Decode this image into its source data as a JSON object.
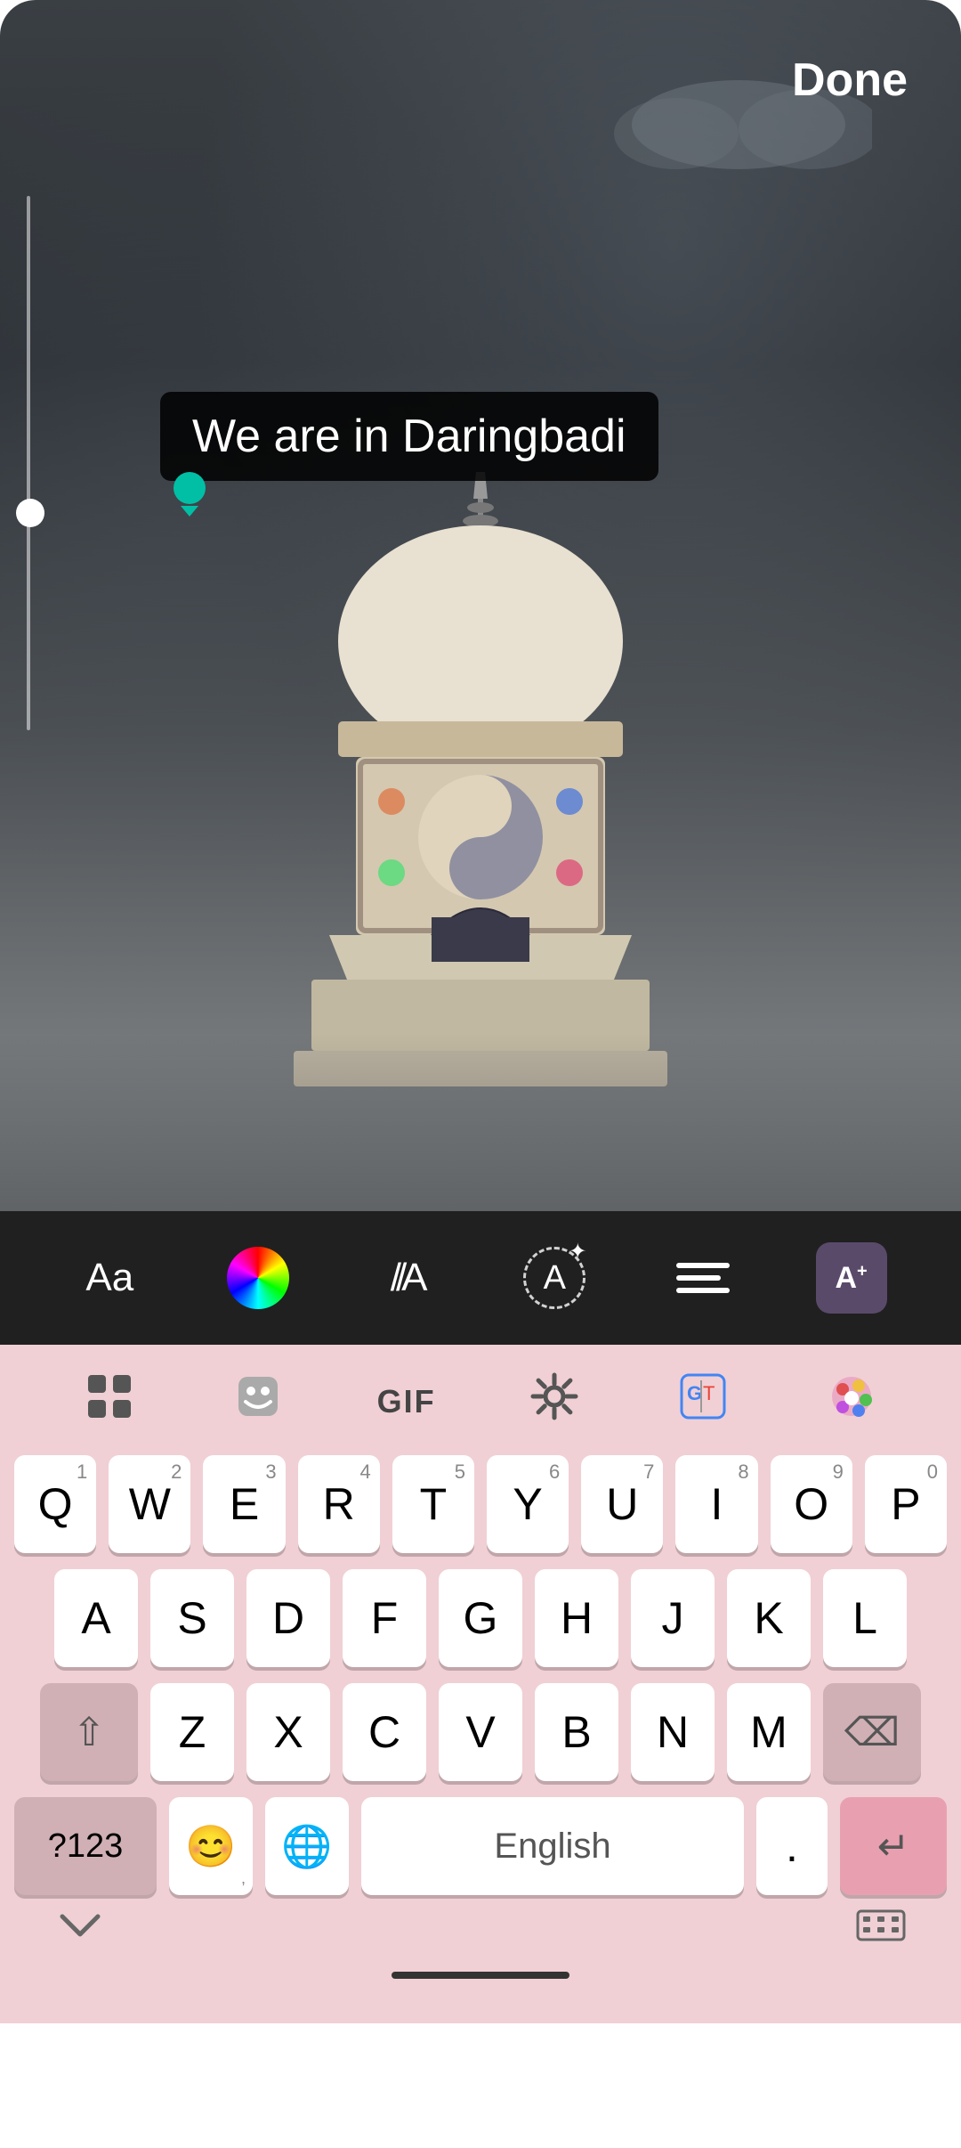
{
  "header": {
    "done_label": "Done"
  },
  "text_overlay": {
    "content": "We are in Daringbadi"
  },
  "toolbar": {
    "aa_label": "Aa",
    "font_label": "//A",
    "align_label": "align",
    "magic_label": "A+"
  },
  "keyboard": {
    "tools": [
      {
        "id": "grid",
        "icon": "⊞"
      },
      {
        "id": "sticker",
        "icon": "😊"
      },
      {
        "id": "gif",
        "label": "GIF"
      },
      {
        "id": "settings",
        "icon": "⚙"
      },
      {
        "id": "translate",
        "icon": "G"
      },
      {
        "id": "palette",
        "icon": "🎨"
      }
    ],
    "rows": [
      {
        "keys": [
          {
            "letter": "Q",
            "number": "1"
          },
          {
            "letter": "W",
            "number": "2"
          },
          {
            "letter": "E",
            "number": "3"
          },
          {
            "letter": "R",
            "number": "4"
          },
          {
            "letter": "T",
            "number": "5"
          },
          {
            "letter": "Y",
            "number": "6"
          },
          {
            "letter": "U",
            "number": "7"
          },
          {
            "letter": "I",
            "number": "8"
          },
          {
            "letter": "O",
            "number": "9"
          },
          {
            "letter": "P",
            "number": "0"
          }
        ]
      },
      {
        "keys": [
          {
            "letter": "A"
          },
          {
            "letter": "S"
          },
          {
            "letter": "D"
          },
          {
            "letter": "F"
          },
          {
            "letter": "G"
          },
          {
            "letter": "H"
          },
          {
            "letter": "J"
          },
          {
            "letter": "K"
          },
          {
            "letter": "L"
          }
        ]
      },
      {
        "keys": [
          {
            "letter": "Z"
          },
          {
            "letter": "X"
          },
          {
            "letter": "C"
          },
          {
            "letter": "V"
          },
          {
            "letter": "B"
          },
          {
            "letter": "N"
          },
          {
            "letter": "M"
          }
        ]
      }
    ],
    "bottom": {
      "numeric_label": "?123",
      "emoji_icon": "😊",
      "globe_icon": "🌐",
      "space_label": "English",
      "period_label": ".",
      "return_icon": "⏎"
    }
  }
}
